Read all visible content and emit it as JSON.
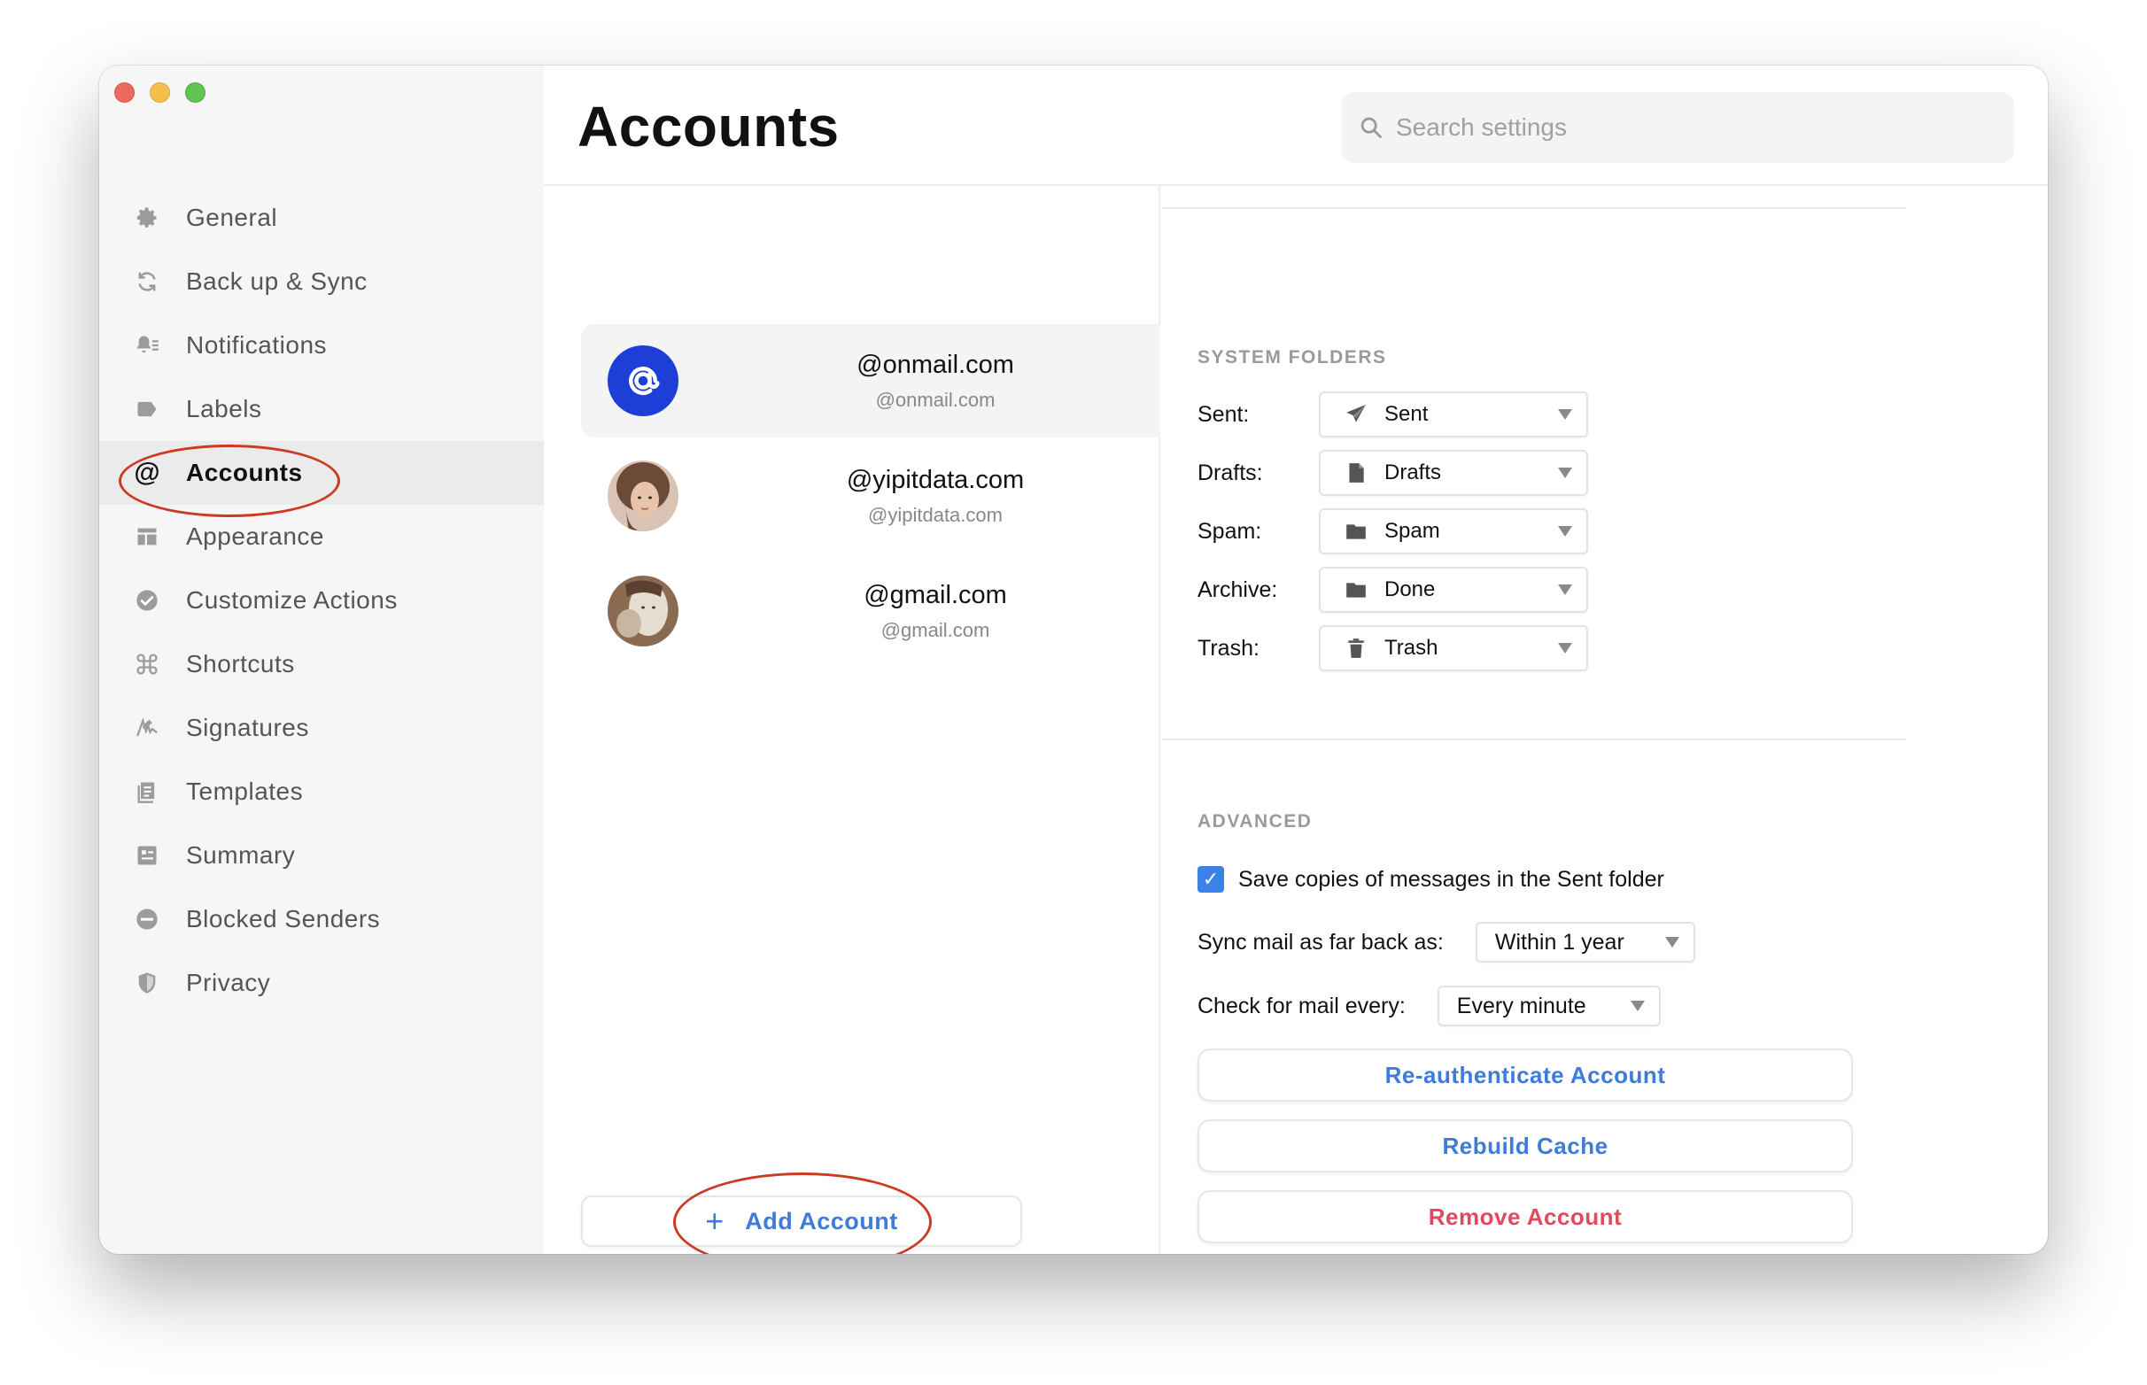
{
  "window": {
    "title": "Accounts"
  },
  "search": {
    "placeholder": "Search settings"
  },
  "sidebar": {
    "items": [
      {
        "label": "General",
        "icon": "gear-icon"
      },
      {
        "label": "Back up & Sync",
        "icon": "sync-icon"
      },
      {
        "label": "Notifications",
        "icon": "bell-icon"
      },
      {
        "label": "Labels",
        "icon": "label-tag-icon"
      },
      {
        "label": "Accounts",
        "icon": "at-sign-icon",
        "active": true
      },
      {
        "label": "Appearance",
        "icon": "layout-icon"
      },
      {
        "label": "Customize Actions",
        "icon": "check-circle-icon"
      },
      {
        "label": "Shortcuts",
        "icon": "command-key-icon"
      },
      {
        "label": "Signatures",
        "icon": "signature-icon"
      },
      {
        "label": "Templates",
        "icon": "templates-icon"
      },
      {
        "label": "Summary",
        "icon": "summary-icon"
      },
      {
        "label": "Blocked Senders",
        "icon": "blocked-icon"
      },
      {
        "label": "Privacy",
        "icon": "shield-icon"
      }
    ],
    "at_glyph": "@"
  },
  "accounts": {
    "list": [
      {
        "name": "@onmail.com",
        "email": "@onmail.com",
        "avatar": "onmail-logo-icon",
        "selected": true
      },
      {
        "name": "@yipitdata.com",
        "email": "@yipitdata.com",
        "avatar": "user-photo-avatar"
      },
      {
        "name": "@gmail.com",
        "email": "@gmail.com",
        "avatar": "user-photo-avatar"
      }
    ],
    "add_button": {
      "plus": "+",
      "label": "Add Account"
    }
  },
  "system_folders": {
    "title": "SYSTEM FOLDERS",
    "rows": [
      {
        "label": "Sent:",
        "value": "Sent",
        "icon": "paper-plane-icon"
      },
      {
        "label": "Drafts:",
        "value": "Drafts",
        "icon": "document-icon"
      },
      {
        "label": "Spam:",
        "value": "Spam",
        "icon": "folder-icon"
      },
      {
        "label": "Archive:",
        "value": "Done",
        "icon": "folder-icon"
      },
      {
        "label": "Trash:",
        "value": "Trash",
        "icon": "trash-icon"
      }
    ]
  },
  "advanced": {
    "title": "ADVANCED",
    "save_copies": {
      "label": "Save copies of messages in the Sent folder",
      "checked": true,
      "check_glyph": "✓"
    },
    "sync_back": {
      "label": "Sync mail as far back as:",
      "value": "Within 1 year"
    },
    "check_every": {
      "label": "Check for mail every:",
      "value": "Every minute"
    },
    "buttons": {
      "reauth": "Re-authenticate Account",
      "rebuild": "Rebuild Cache",
      "remove": "Remove Account"
    }
  },
  "colors": {
    "accent_blue": "#3d7bdc",
    "danger_red": "#e04a5c",
    "annotation_red": "#cc3a22",
    "checkbox_blue": "#3b82e6",
    "onmail_blue": "#1d3fd8"
  }
}
